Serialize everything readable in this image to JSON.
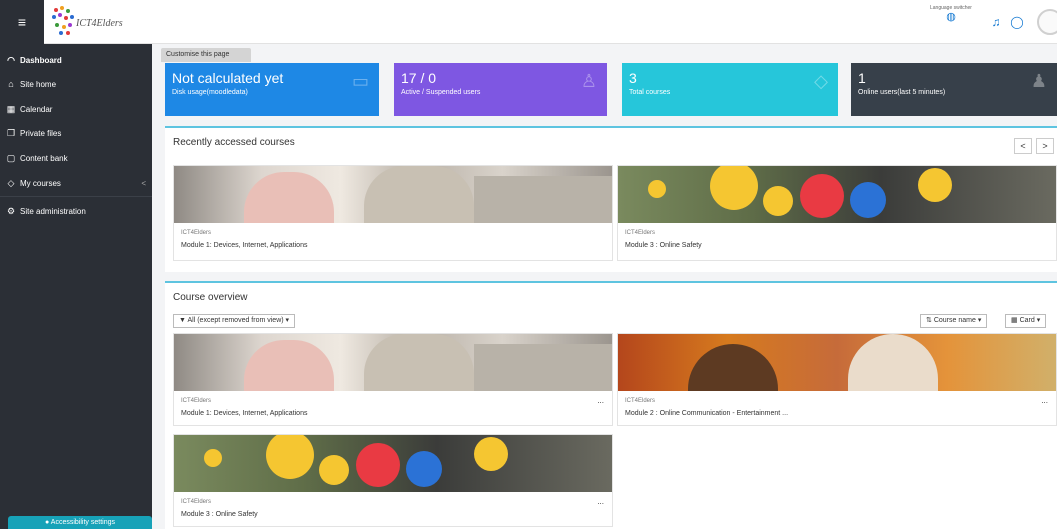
{
  "header": {
    "menu_icon": "hamburger-icon",
    "logo_text": "ICT4Elders",
    "language_switcher_label": "Language switcher",
    "icons": [
      "globe-icon",
      "bell-icon",
      "chat-icon",
      "user-avatar"
    ]
  },
  "sidebar": {
    "items": [
      {
        "label": "Dashboard",
        "icon": "dashboard-icon",
        "active": true
      },
      {
        "label": "Site home",
        "icon": "home-icon"
      },
      {
        "label": "Calendar",
        "icon": "calendar-icon"
      },
      {
        "label": "Private files",
        "icon": "files-icon"
      },
      {
        "label": "Content bank",
        "icon": "content-bank-icon"
      },
      {
        "label": "My courses",
        "icon": "graduation-cap-icon"
      },
      {
        "label": "Site administration",
        "icon": "gear-icon"
      }
    ],
    "my_courses_chevron": "<",
    "accessibility_label": "Accessibility settings"
  },
  "customise_label": "Customise this page",
  "stats": [
    {
      "value": "Not calculated yet",
      "label": "Disk usage(moodledata)",
      "color": "#1e88e5",
      "icon": "inbox-icon"
    },
    {
      "value": "17 / 0",
      "label": "Active / Suspended users",
      "color": "#7e57e2",
      "icon": "users-icon"
    },
    {
      "value": "3",
      "label": "Total courses",
      "color": "#26c6da",
      "icon": "graduation-cap-icon"
    },
    {
      "value": "1",
      "label": "Online users(last 5 minutes)",
      "color": "#37404a",
      "icon": "online-users-icon"
    }
  ],
  "recent": {
    "title": "Recently accessed courses",
    "prev": "<",
    "next": ">",
    "courses": [
      {
        "category": "ICT4Elders",
        "name": "Module 1: Devices, Internet, Applications"
      },
      {
        "category": "ICT4Elders",
        "name": "Module 3 : Online Safety"
      }
    ]
  },
  "overview": {
    "title": "Course overview",
    "filter_label": "All (except removed from view)",
    "sort_label": "Course name",
    "view_label": "Card",
    "courses": [
      {
        "category": "ICT4Elders",
        "name": "Module 1: Devices, Internet, Applications",
        "menu": "..."
      },
      {
        "category": "ICT4Elders",
        "name": "Module 2 : Online Communication - Entertainment ...",
        "menu": "..."
      },
      {
        "category": "ICT4Elders",
        "name": "Module 3 : Online Safety",
        "menu": "..."
      }
    ]
  }
}
